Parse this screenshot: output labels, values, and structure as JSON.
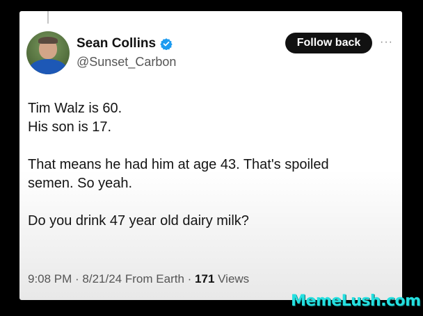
{
  "tweet": {
    "author": {
      "display_name": "Sean Collins",
      "handle": "@Sunset_Carbon",
      "verified": true
    },
    "follow_button_label": "Follow back",
    "more_label": "···",
    "text_lines": [
      "Tim Walz is 60.",
      "His son is 17.",
      "",
      "That means he had him at age 43. That's spoiled",
      "semen. So yeah.",
      "",
      "Do you drink 47 year old dairy milk?"
    ],
    "time": "9:08 PM",
    "date": "8/21/24",
    "source": "From Earth",
    "views_count": "171",
    "views_label": "Views",
    "separator": " · "
  },
  "watermark": "MemeLush.com",
  "colors": {
    "verified_badge": "#1d9bf0",
    "watermark": "#25e0e0",
    "button_bg": "#111111"
  }
}
